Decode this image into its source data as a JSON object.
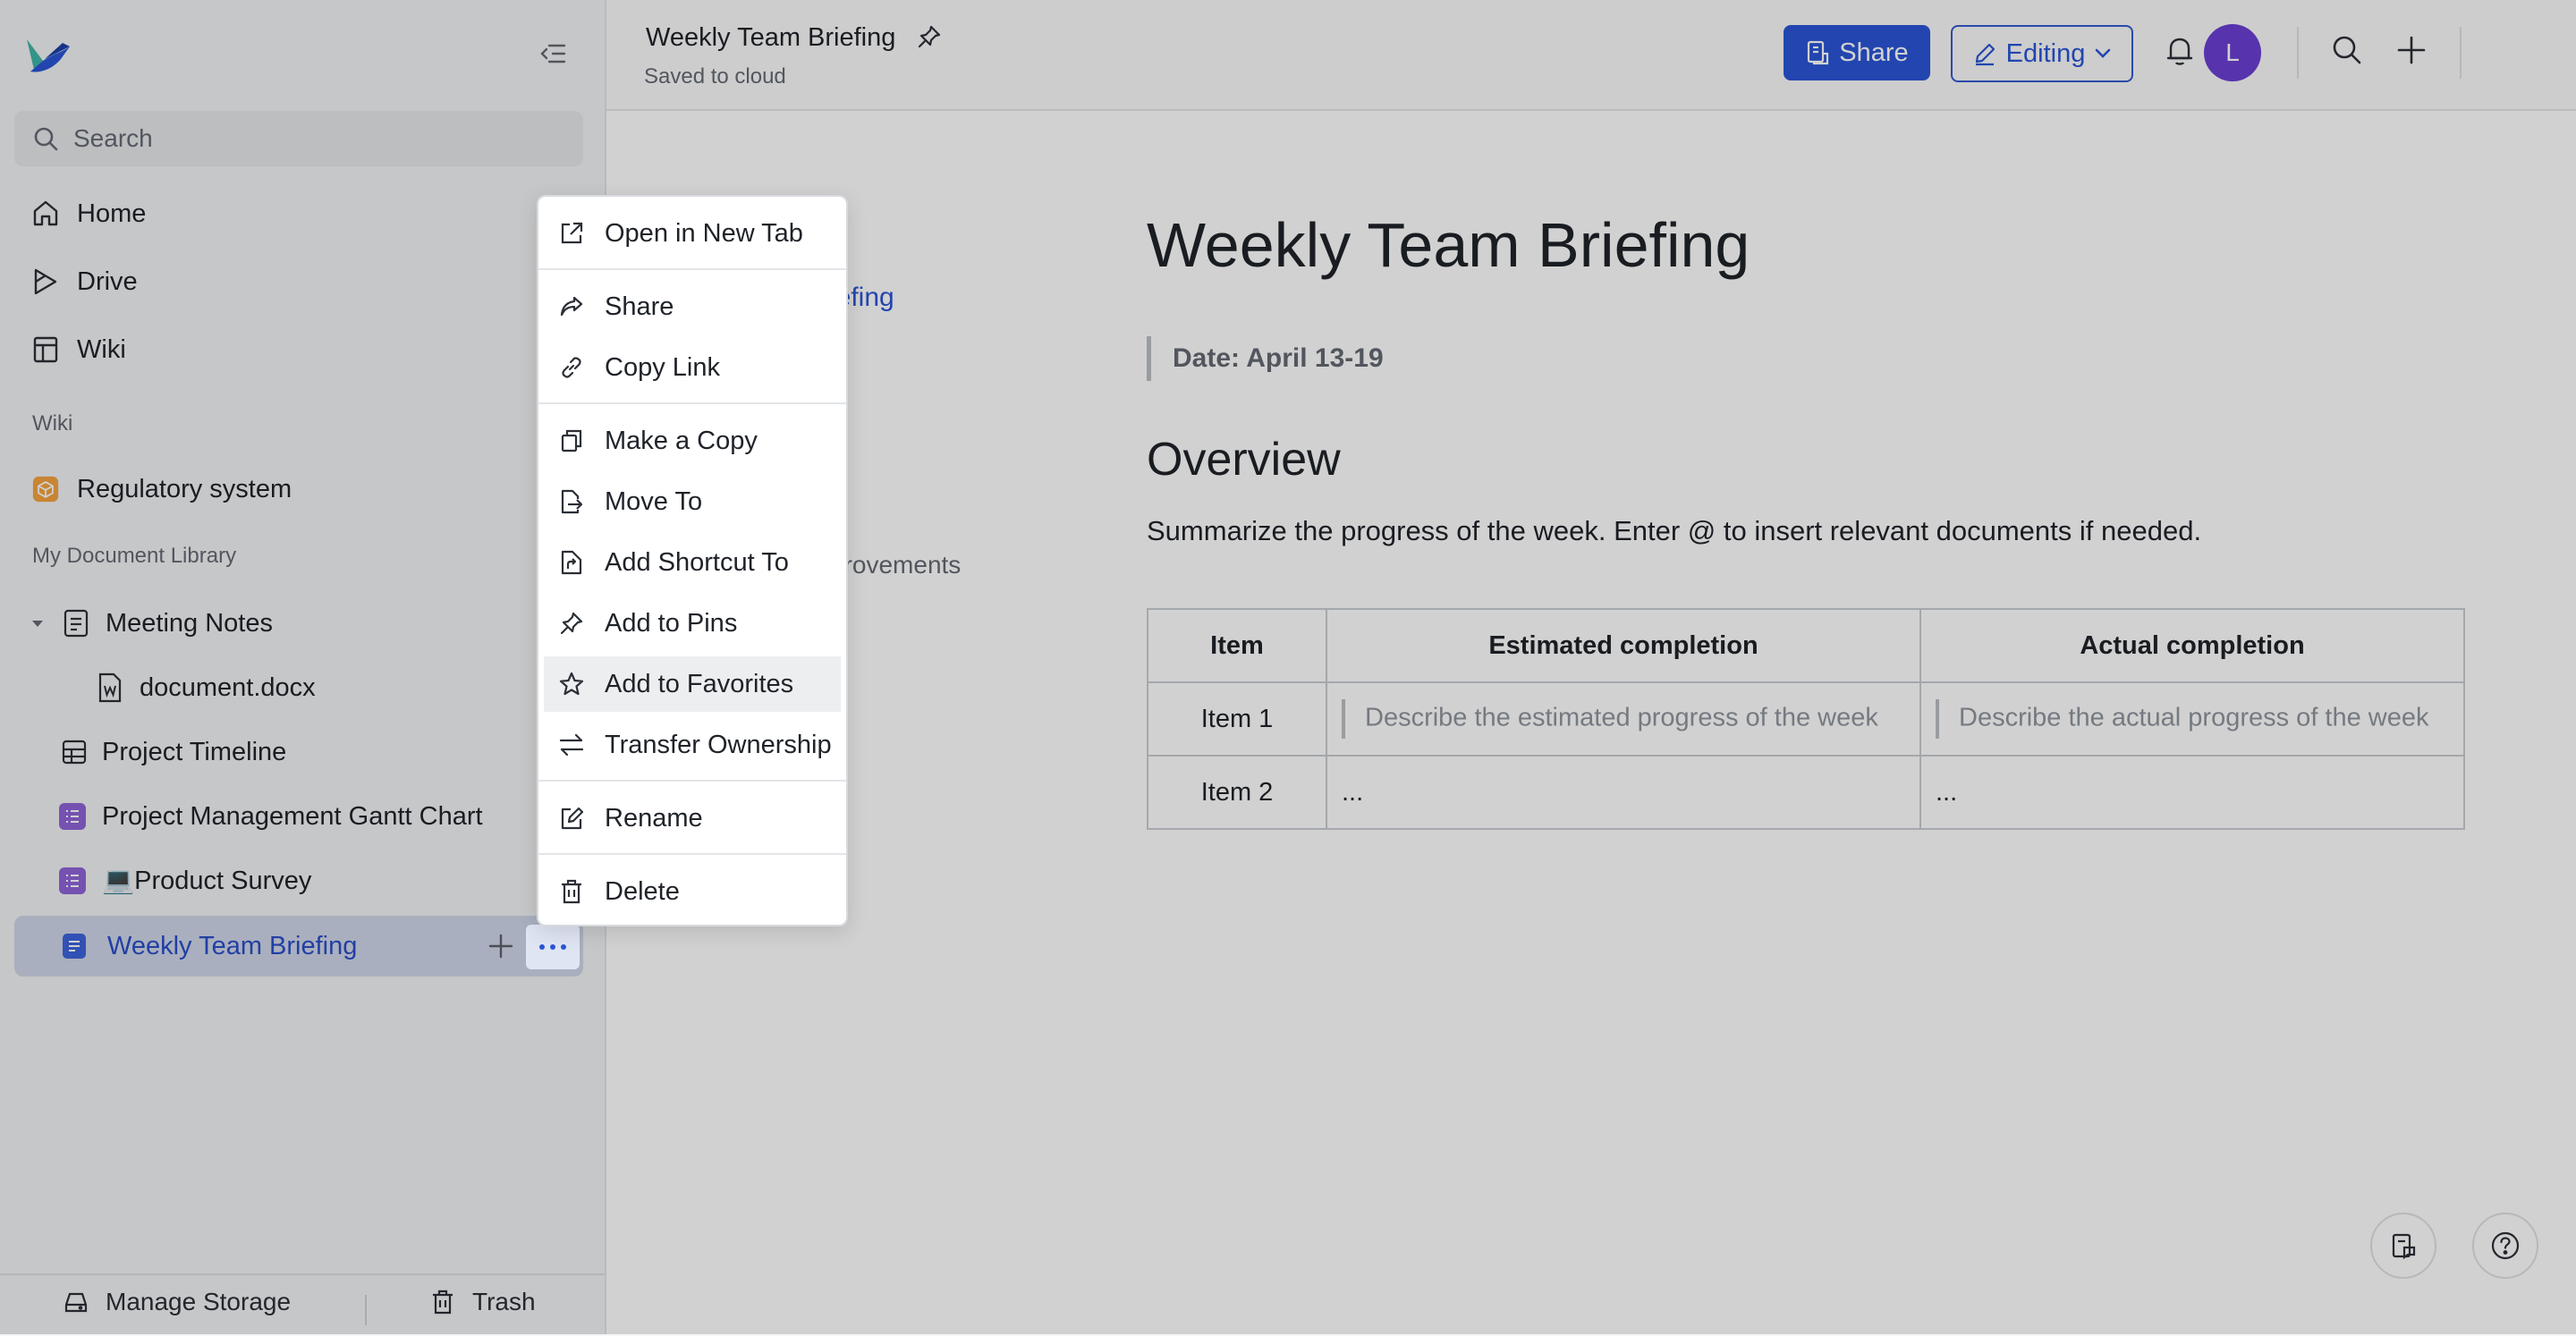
{
  "sidebar": {
    "search_placeholder": "Search",
    "nav": [
      {
        "label": "Home",
        "icon": "home-icon"
      },
      {
        "label": "Drive",
        "icon": "drive-icon"
      },
      {
        "label": "Wiki",
        "icon": "wiki-icon"
      }
    ],
    "wiki_section": "Wiki",
    "wiki_items": [
      {
        "label": "Regulatory system",
        "icon": "cube-icon"
      }
    ],
    "library_section": "My Document Library",
    "tree": [
      {
        "label": "Meeting Notes",
        "icon": "doc-icon",
        "expanded": true
      },
      {
        "label": "document.docx",
        "icon": "word-file-icon"
      },
      {
        "label": "Project Timeline",
        "icon": "table-icon"
      },
      {
        "label": "Project Management Gantt Chart",
        "icon": "gantt-icon"
      },
      {
        "label": "💻Product Survey",
        "icon": "form-icon"
      },
      {
        "label": "Weekly Team Briefing",
        "icon": "doc-icon",
        "active": true
      }
    ],
    "bottom": {
      "manage_storage": "Manage Storage",
      "trash": "Trash"
    }
  },
  "header": {
    "title": "Weekly Team Briefing",
    "status": "Saved to cloud",
    "share_label": "Share",
    "editing_label": "Editing",
    "avatar_initial": "L"
  },
  "document": {
    "toc_link": "iefing",
    "toc_item": "provements",
    "title": "Weekly Team Briefing",
    "date": "Date: April 13-19",
    "heading": "Overview",
    "paragraph": "Summarize the progress of the week. Enter @ to insert relevant documents if needed.",
    "table": {
      "headers": [
        "Item",
        "Estimated completion",
        "Actual completion"
      ],
      "rows": [
        [
          "Item 1",
          "Describe the estimated progress of the week",
          "Describe the actual progress of the week"
        ],
        [
          "Item 2",
          "...",
          "..."
        ]
      ]
    }
  },
  "context_menu": {
    "items": [
      {
        "label": "Open in New Tab",
        "icon": "external-link-icon"
      },
      {
        "label": "Share",
        "icon": "share-icon"
      },
      {
        "label": "Copy Link",
        "icon": "link-icon"
      },
      {
        "label": "Make a Copy",
        "icon": "copy-icon"
      },
      {
        "label": "Move To",
        "icon": "move-icon"
      },
      {
        "label": "Add Shortcut To",
        "icon": "shortcut-icon"
      },
      {
        "label": "Add to Pins",
        "icon": "pin-icon"
      },
      {
        "label": "Add to Favorites",
        "icon": "star-icon",
        "highlighted": true
      },
      {
        "label": "Transfer Ownership",
        "icon": "transfer-icon"
      },
      {
        "label": "Rename",
        "icon": "rename-icon"
      },
      {
        "label": "Delete",
        "icon": "trash-icon"
      }
    ]
  },
  "colors": {
    "accent": "#2a55d6",
    "avatar": "#6b3fd3",
    "active_bg": "#cfd6e8"
  }
}
